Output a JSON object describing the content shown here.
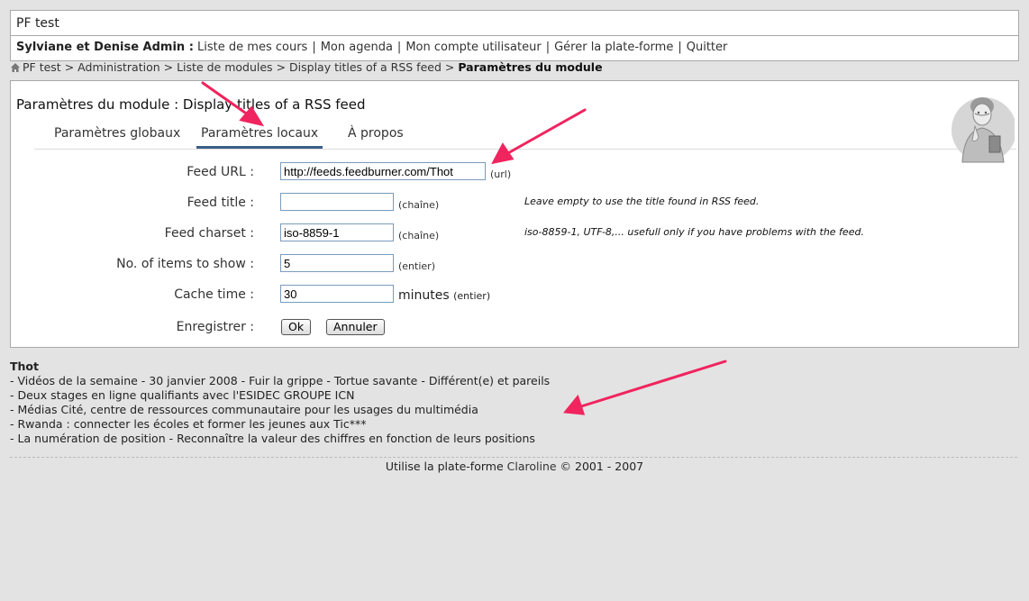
{
  "site": {
    "title": "PF test"
  },
  "user_bar": {
    "user_name": "Sylviane et Denise Admin :",
    "links": [
      "Liste de mes cours",
      "Mon agenda",
      "Mon compte utilisateur",
      "Gérer la plate-forme",
      "Quitter"
    ]
  },
  "breadcrumb": {
    "items": [
      "PF test",
      "Administration",
      "Liste de modules",
      "Display titles of a RSS feed"
    ],
    "current": "Paramètres du module",
    "sep": ">"
  },
  "page": {
    "title": "Paramètres du module : Display titles of a RSS feed",
    "tabs": [
      "Paramètres globaux",
      "Paramètres locaux",
      "À propos"
    ],
    "active_tab": "Paramètres locaux"
  },
  "form": {
    "feed_url": {
      "label": "Feed URL :",
      "value": "http://feeds.feedburner.com/Thot",
      "hint": "(url)"
    },
    "feed_title": {
      "label": "Feed title :",
      "value": "",
      "hint": "(chaîne)",
      "help": "Leave empty to use the title found in RSS feed."
    },
    "feed_charset": {
      "label": "Feed charset :",
      "value": "iso-8859-1",
      "hint": "(chaîne)",
      "help": "iso-8859-1, UTF-8,... usefull only if you have problems with the feed."
    },
    "items_to_show": {
      "label": "No. of items to show :",
      "value": "5",
      "hint": "(entier)"
    },
    "cache_time": {
      "label": "Cache time :",
      "value": "30",
      "unit": "minutes",
      "hint": "(entier)"
    },
    "save": {
      "label": "Enregistrer :",
      "ok": "Ok",
      "cancel": "Annuler"
    }
  },
  "rss": {
    "title": "Thot",
    "items": [
      "- Vidéos de la semaine - 30 janvier 2008 - Fuir la grippe - Tortue savante - Différent(e) et pareils",
      "- Deux stages en ligne qualifiants avec l'ESIDEC GROUPE ICN",
      "- Médias Cité, centre de ressources communautaire pour les usages du multimédia",
      "- Rwanda : connecter les écoles et former les jeunes aux Tic***",
      "- La numération de position - Reconnaître la valeur des chiffres en fonction de leurs positions"
    ]
  },
  "footer": {
    "prefix": "Utilise la plate-forme",
    "link": "Claroline",
    "suffix": "© 2001 - 2007"
  },
  "colors": {
    "accent": "#3b5f88",
    "annotation_arrow": "#f0245e",
    "background": "#e3e3e3"
  }
}
